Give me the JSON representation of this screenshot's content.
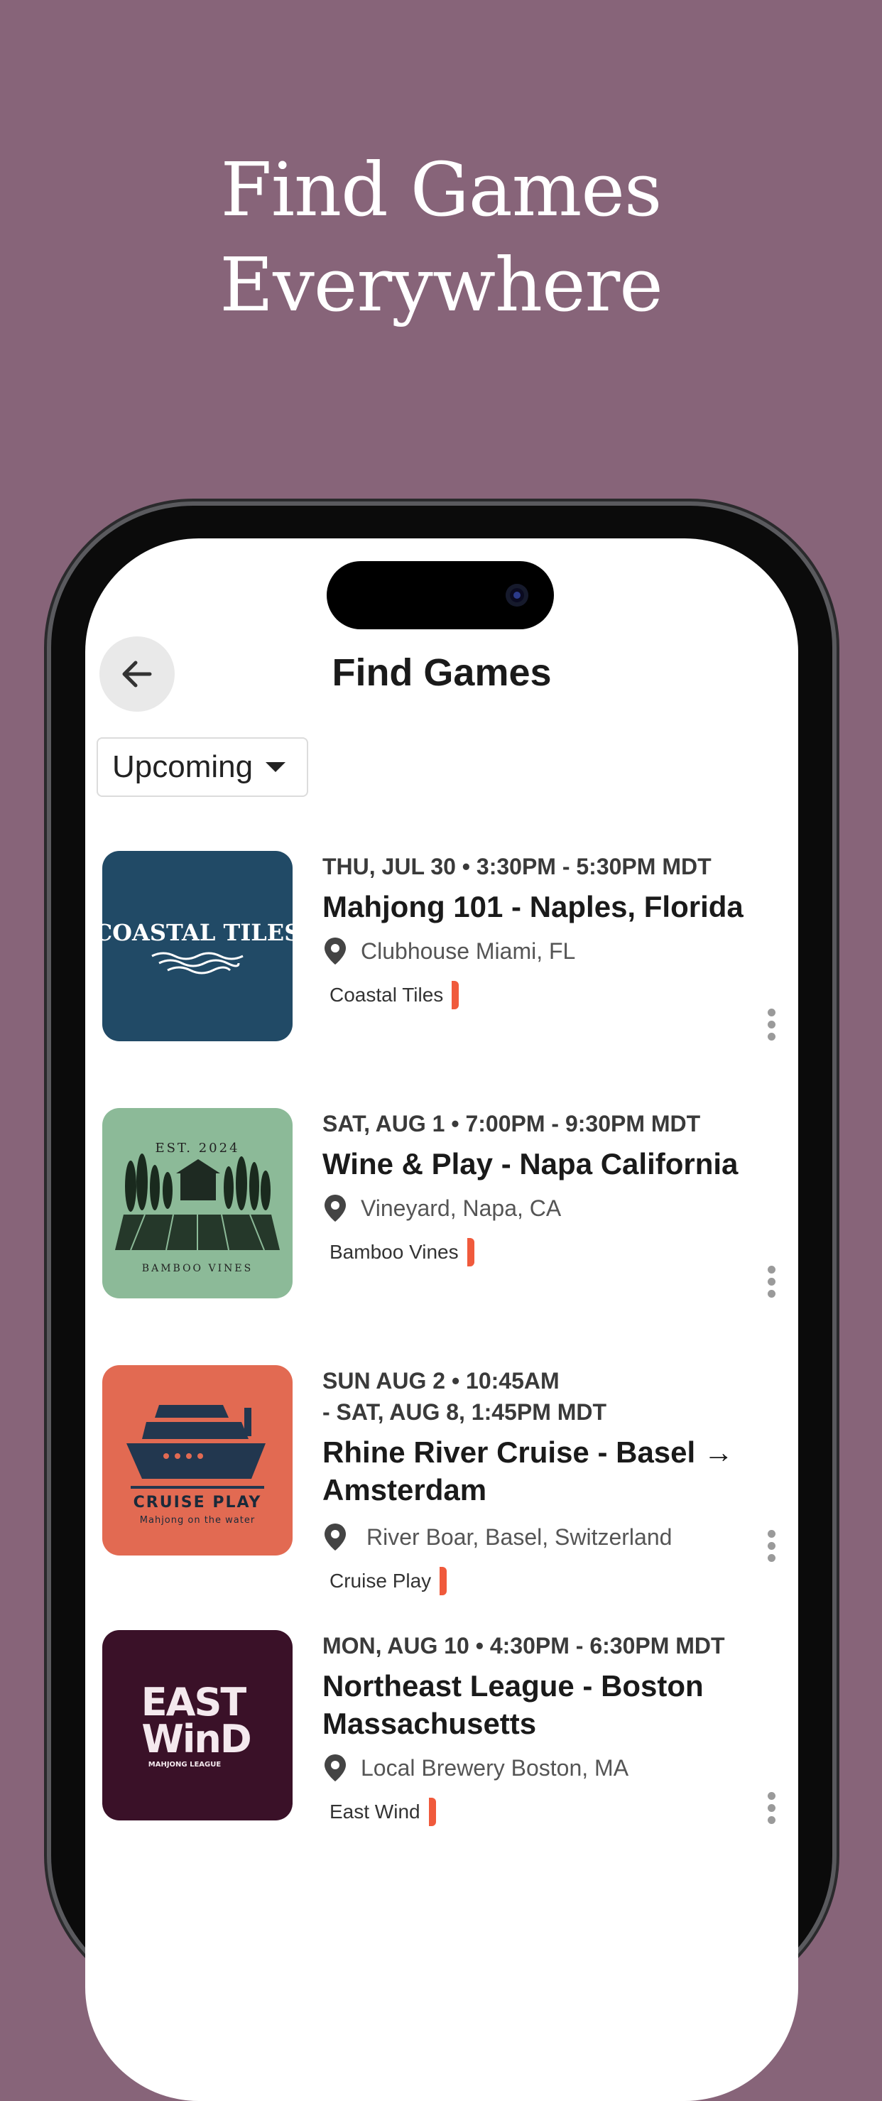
{
  "hero": {
    "line1": "Find Games",
    "line2": "Everywhere"
  },
  "header": {
    "title": "Find Games"
  },
  "filter": {
    "selected": "Upcoming"
  },
  "colors": {
    "background": "#876479",
    "accent": "#f05a3c"
  },
  "events": [
    {
      "date": "THU, JUL 30 • 3:30PM - 5:30PM MDT",
      "name": "Mahjong 101 - Naples, Florida",
      "location": "Clubhouse Miami, FL",
      "host": "Coastal Tiles",
      "logo_text": "COASTAL TILES"
    },
    {
      "date": "SAT, AUG 1 • 7:00PM - 9:30PM MDT",
      "name": "Wine & Play - Napa California",
      "location": "Vineyard, Napa, CA",
      "host": "Bamboo Vines",
      "logo_text_top": "EST. 2024",
      "logo_text_bottom": "BAMBOO VINES"
    },
    {
      "date_line1": "SUN AUG 2 • 10:45AM",
      "date_line2": "- SAT, AUG 8, 1:45PM MDT",
      "name": "Rhine River Cruise - Basel → Amsterdam",
      "location": "River Boar, Basel, Switzerland",
      "host": "Cruise Play",
      "logo_text": "CRUISE PLAY",
      "logo_subtext": "Mahjong on the water"
    },
    {
      "date": "MON, AUG 10 • 4:30PM - 6:30PM MDT",
      "name": "Northeast League - Boston Massachusetts",
      "location": "Local Brewery Boston, MA",
      "host": "East Wind",
      "logo_text_1": "EAST",
      "logo_text_2": "WinD",
      "logo_subtext": "MAHJONG LEAGUE"
    }
  ]
}
